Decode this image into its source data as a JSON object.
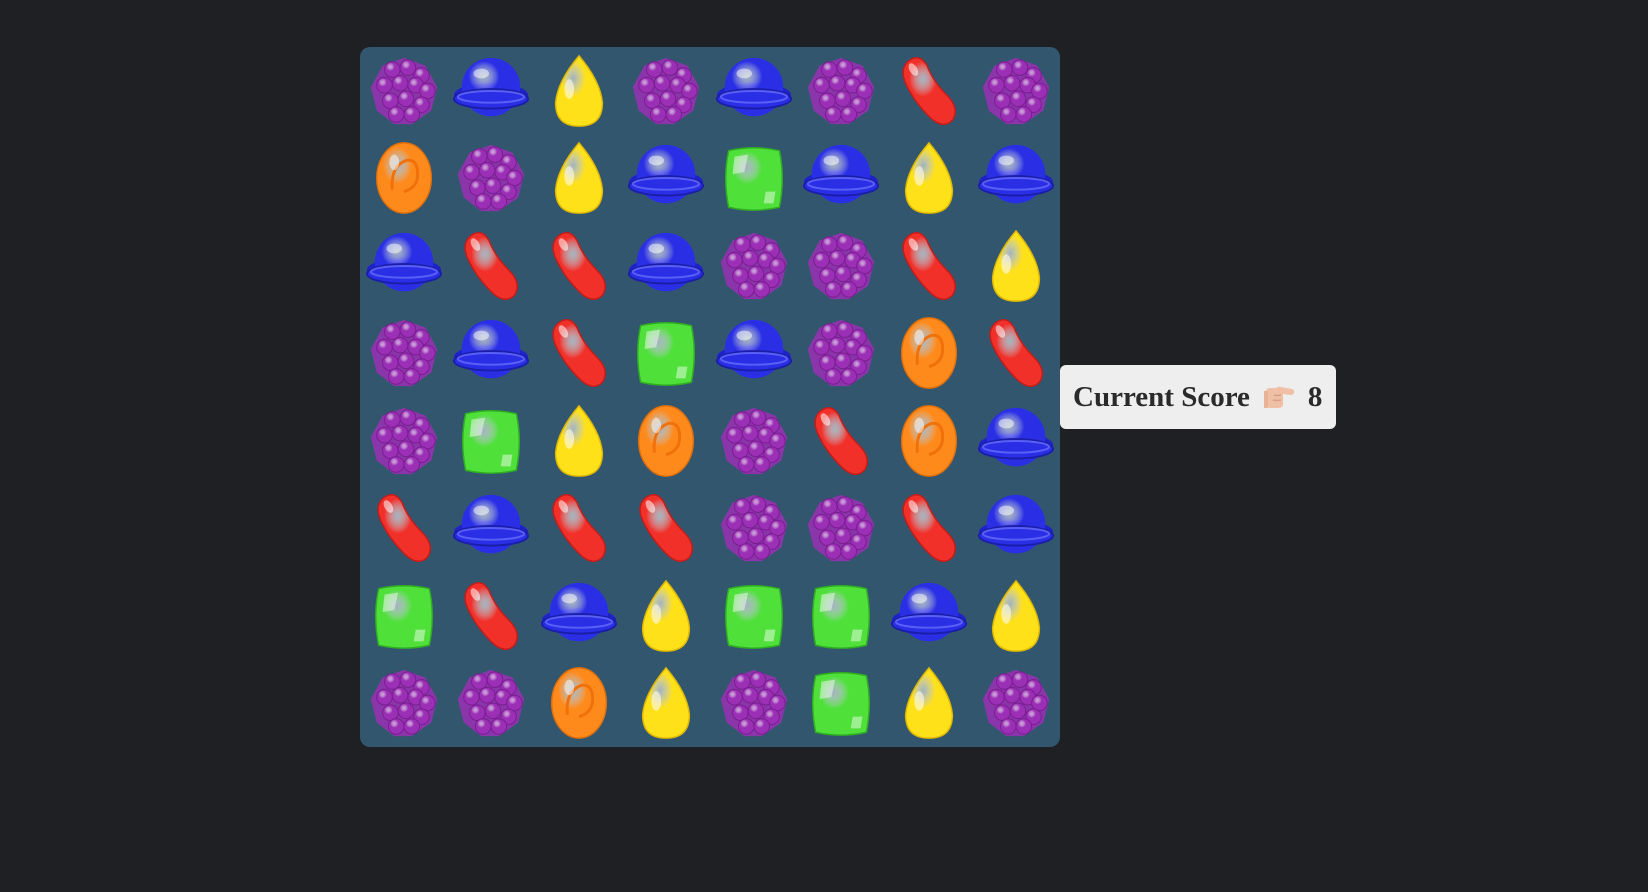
{
  "score": {
    "label": "Current Score",
    "pointer_icon": "pointing-finger-right-icon",
    "value": "8"
  },
  "board": {
    "rows": 8,
    "cols": 8,
    "grid": [
      [
        "purple",
        "blue",
        "yellow",
        "purple",
        "blue",
        "purple",
        "red",
        "purple"
      ],
      [
        "orange",
        "purple",
        "yellow",
        "blue",
        "green",
        "blue",
        "yellow",
        "blue"
      ],
      [
        "blue",
        "red",
        "red",
        "blue",
        "purple",
        "purple",
        "red",
        "yellow"
      ],
      [
        "purple",
        "blue",
        "red",
        "green",
        "blue",
        "purple",
        "orange",
        "red"
      ],
      [
        "purple",
        "green",
        "yellow",
        "orange",
        "purple",
        "red",
        "orange",
        "blue"
      ],
      [
        "red",
        "blue",
        "red",
        "red",
        "purple",
        "purple",
        "red",
        "blue"
      ],
      [
        "green",
        "red",
        "blue",
        "yellow",
        "green",
        "green",
        "blue",
        "yellow"
      ],
      [
        "purple",
        "purple",
        "orange",
        "yellow",
        "purple",
        "green",
        "yellow",
        "purple"
      ]
    ]
  },
  "candy_types": {
    "purple": {
      "icon": "purple-cluster-candy-icon",
      "color": "#9b2fb5"
    },
    "blue": {
      "icon": "blue-lollipop-candy-icon",
      "color": "#2a2fe6"
    },
    "yellow": {
      "icon": "yellow-drop-candy-icon",
      "color": "#ffe119"
    },
    "red": {
      "icon": "red-bean-candy-icon",
      "color": "#f2302a"
    },
    "orange": {
      "icon": "orange-lozenge-candy-icon",
      "color": "#ff8a1c"
    },
    "green": {
      "icon": "green-square-candy-icon",
      "color": "#4fe03a"
    }
  }
}
